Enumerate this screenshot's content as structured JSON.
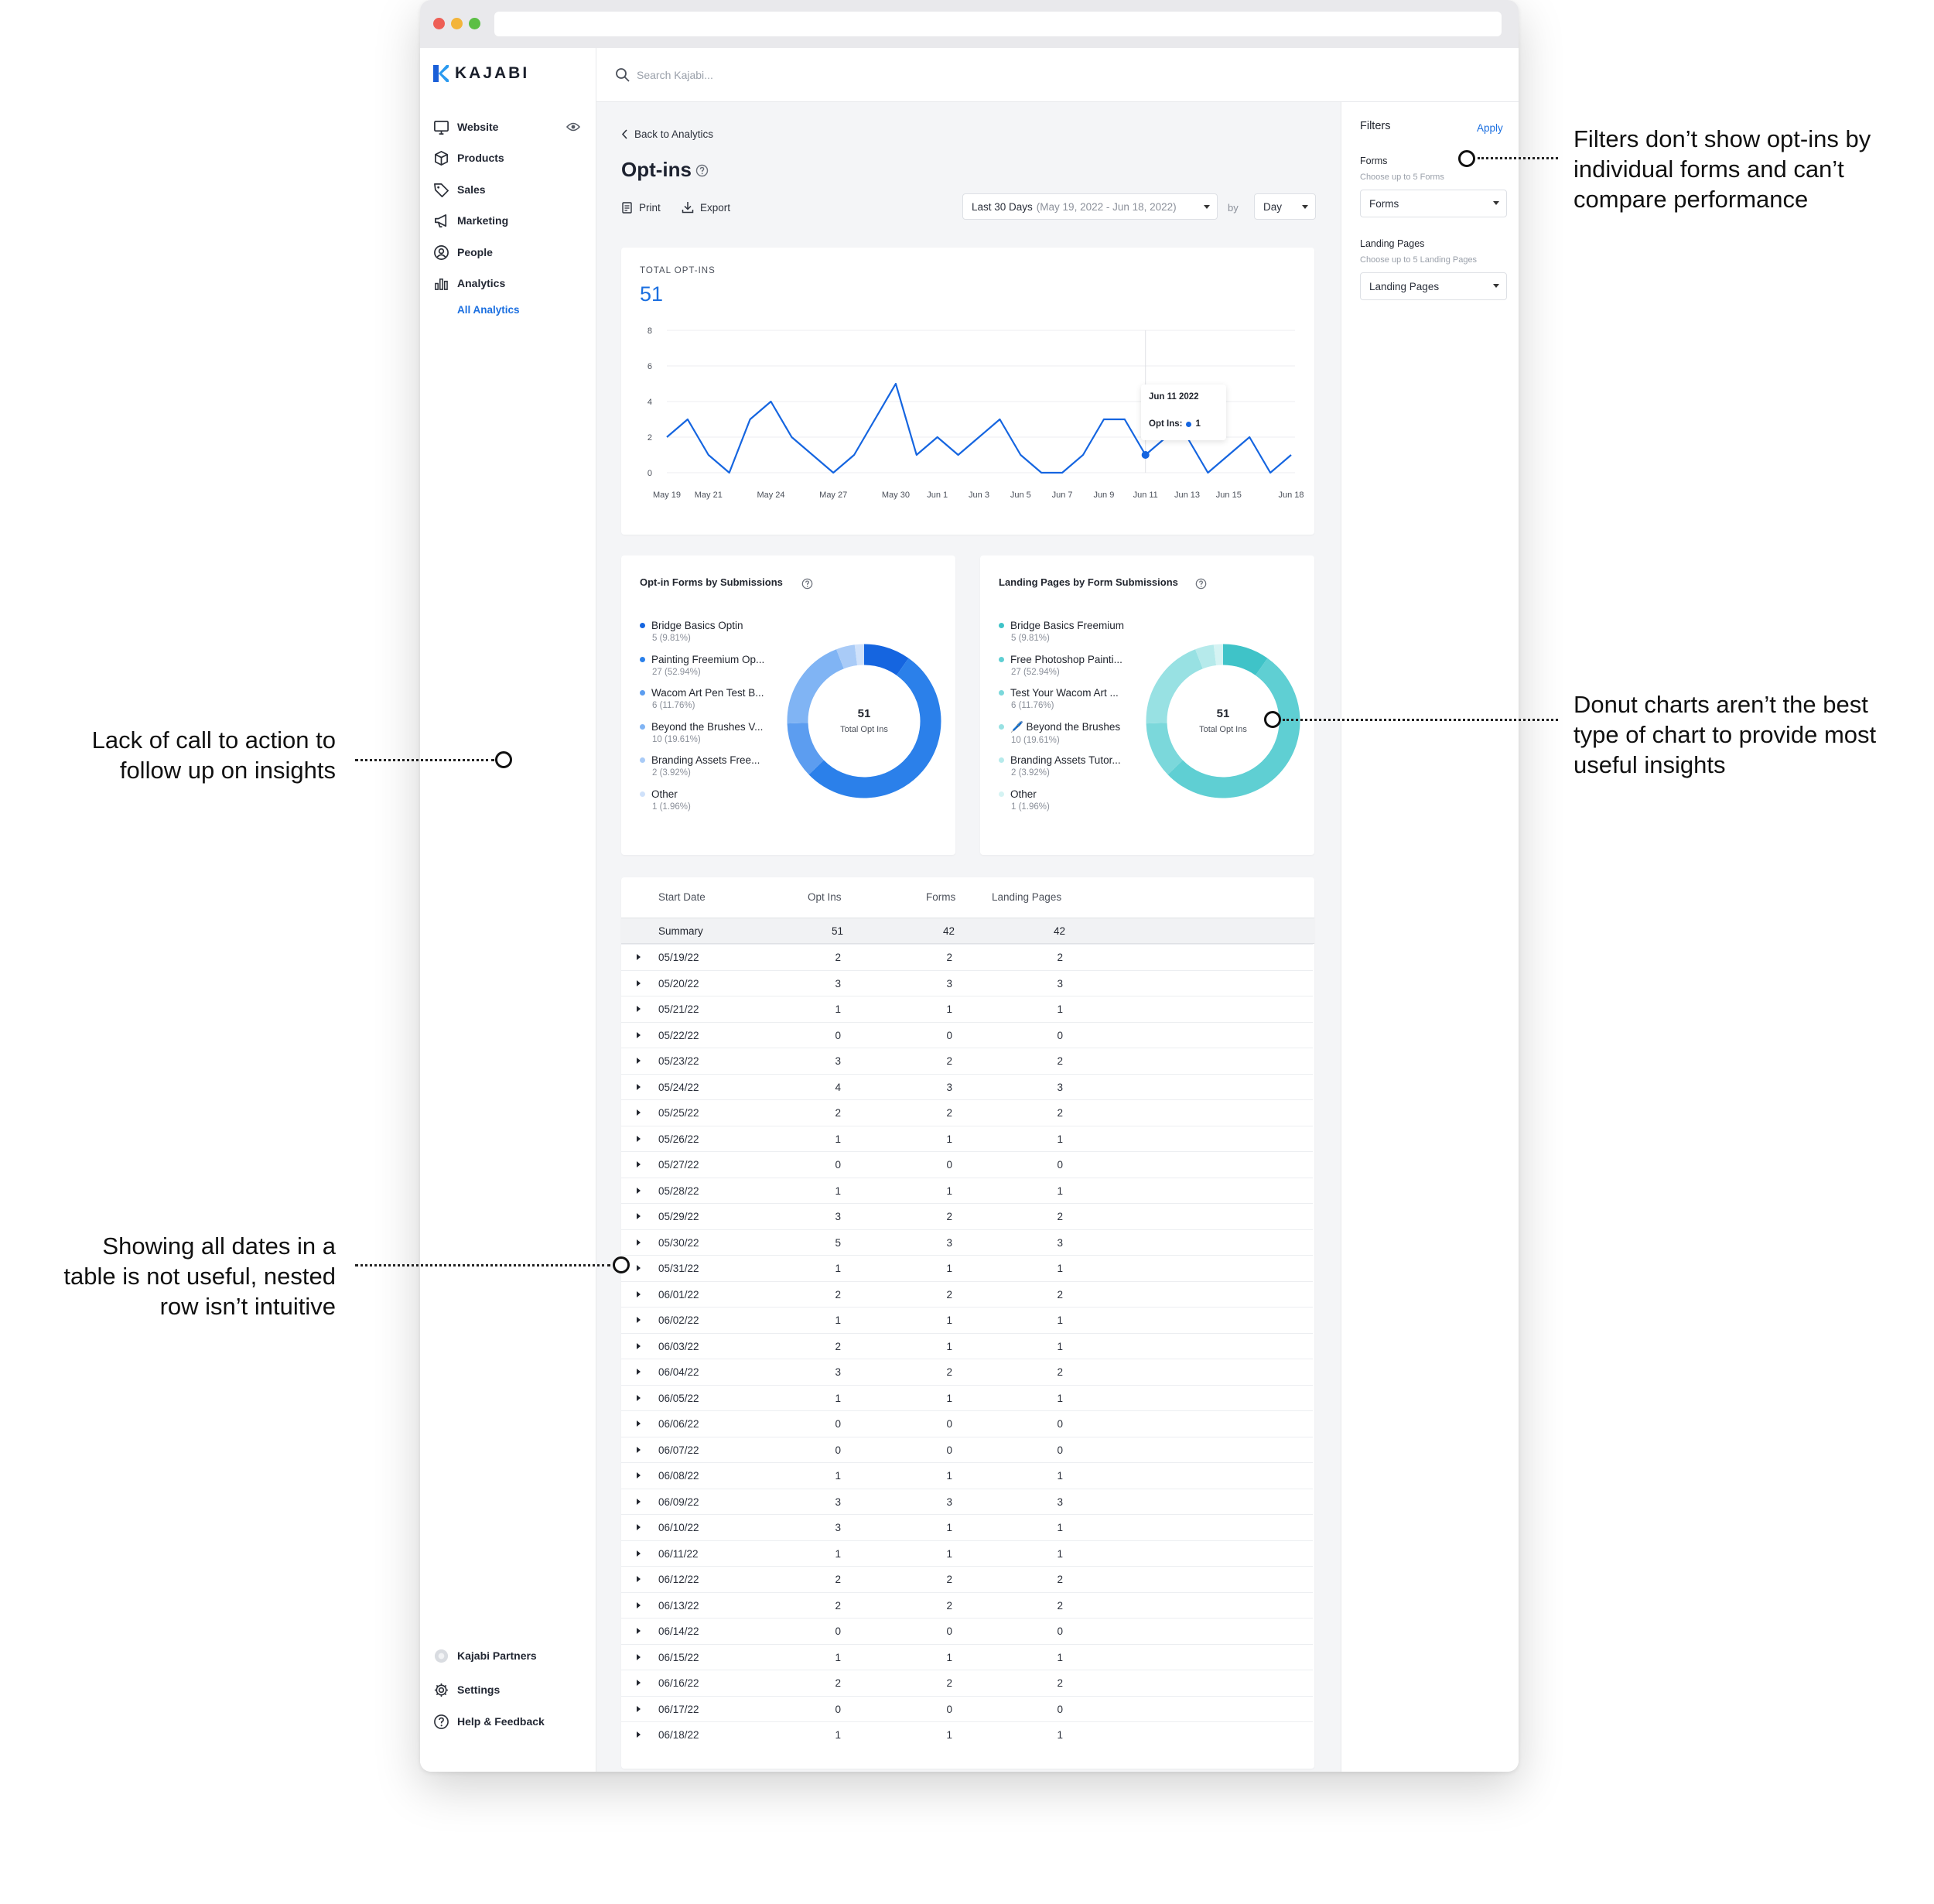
{
  "app": {
    "logo": "KAJABI"
  },
  "search": {
    "placeholder": "Search Kajabi..."
  },
  "sidebar": {
    "items": [
      {
        "label": "Website",
        "icon": "monitor-icon"
      },
      {
        "label": "Products",
        "icon": "box-icon"
      },
      {
        "label": "Sales",
        "icon": "tag-icon"
      },
      {
        "label": "Marketing",
        "icon": "megaphone-icon"
      },
      {
        "label": "People",
        "icon": "person-circle-icon"
      },
      {
        "label": "Analytics",
        "icon": "bar-chart-icon"
      }
    ],
    "sub_item": "All Analytics",
    "bottom": [
      {
        "label": "Kajabi Partners",
        "icon": "partner-icon"
      },
      {
        "label": "Settings",
        "icon": "gear-icon"
      },
      {
        "label": "Help & Feedback",
        "icon": "help-icon"
      }
    ]
  },
  "page": {
    "back": "Back to Analytics",
    "title": "Opt-ins",
    "print": "Print",
    "export": "Export",
    "range_main": "Last 30 Days",
    "range_dates": "(May 19, 2022 - Jun 18, 2022)",
    "by": "by",
    "interval": "Day"
  },
  "filters": {
    "title": "Filters",
    "apply": "Apply",
    "forms_label": "Forms",
    "forms_hint": "Choose up to 5 Forms",
    "forms_value": "Forms",
    "lp_label": "Landing Pages",
    "lp_hint": "Choose up to 5 Landing Pages",
    "lp_value": "Landing Pages"
  },
  "total": {
    "label": "TOTAL OPT-INS",
    "value": "51"
  },
  "chart_data": [
    {
      "type": "line",
      "x": [
        "May 19",
        "May 20",
        "May 21",
        "May 22",
        "May 23",
        "May 24",
        "May 25",
        "May 26",
        "May 27",
        "May 28",
        "May 29",
        "May 30",
        "May 31",
        "Jun 1",
        "Jun 2",
        "Jun 3",
        "Jun 4",
        "Jun 5",
        "Jun 6",
        "Jun 7",
        "Jun 8",
        "Jun 9",
        "Jun 10",
        "Jun 11",
        "Jun 12",
        "Jun 13",
        "Jun 14",
        "Jun 15",
        "Jun 16",
        "Jun 17",
        "Jun 18"
      ],
      "series": [
        {
          "name": "Opt Ins",
          "values": [
            2,
            3,
            1,
            0,
            3,
            4,
            2,
            1,
            0,
            1,
            3,
            5,
            1,
            2,
            1,
            2,
            3,
            1,
            0,
            0,
            1,
            3,
            3,
            1,
            2,
            2,
            0,
            1,
            2,
            0,
            1
          ]
        }
      ],
      "x_tick_labels": [
        "May 19",
        "May 21",
        "May 24",
        "May 27",
        "May 30",
        "Jun 1",
        "Jun 3",
        "Jun 5",
        "Jun 7",
        "Jun 9",
        "Jun 11",
        "Jun 13",
        "Jun 15",
        "Jun 18"
      ],
      "y_ticks": [
        "0",
        "2",
        "4",
        "6",
        "8"
      ],
      "ylim": [
        0,
        8
      ],
      "grid": true,
      "tooltip": {
        "date": "Jun 11 2022",
        "label": "Opt Ins:",
        "value": "1"
      }
    },
    {
      "type": "pie",
      "title": "Opt-in Forms by Submissions",
      "center_value": "51",
      "center_label": "Total Opt Ins",
      "slices": [
        {
          "name": "Bridge Basics Optin",
          "value": 5,
          "pct": "5 (9.81%)",
          "color": "#1565e0"
        },
        {
          "name": "Painting Freemium Op...",
          "value": 27,
          "pct": "27 (52.94%)",
          "color": "#2b80ea"
        },
        {
          "name": "Wacom Art Pen Test B...",
          "value": 6,
          "pct": "6 (11.76%)",
          "color": "#5c9df0"
        },
        {
          "name": "Beyond the Brushes V...",
          "value": 10,
          "pct": "10 (19.61%)",
          "color": "#80b4f4"
        },
        {
          "name": "Branding Assets Free...",
          "value": 2,
          "pct": "2 (3.92%)",
          "color": "#a9cbf7"
        },
        {
          "name": "Other",
          "value": 1,
          "pct": "1 (1.96%)",
          "color": "#cfe1fa"
        }
      ]
    },
    {
      "type": "pie",
      "title": "Landing Pages by Form Submissions",
      "center_value": "51",
      "center_label": "Total Opt Ins",
      "slices": [
        {
          "name": "Bridge Basics Freemium",
          "value": 5,
          "pct": "5 (9.81%)",
          "color": "#3fc3c8"
        },
        {
          "name": "Free Photoshop Painti...",
          "value": 27,
          "pct": "27 (52.94%)",
          "color": "#5fcfd3"
        },
        {
          "name": "Test Your Wacom Art ...",
          "value": 6,
          "pct": "6 (11.76%)",
          "color": "#7bd8db"
        },
        {
          "name": "🖊️ Beyond the Brushes",
          "value": 10,
          "pct": "10 (19.61%)",
          "color": "#98e1e3"
        },
        {
          "name": "Branding Assets Tutor...",
          "value": 2,
          "pct": "2 (3.92%)",
          "color": "#b6eaeb"
        },
        {
          "name": "Other",
          "value": 1,
          "pct": "1 (1.96%)",
          "color": "#d5f3f3"
        }
      ]
    }
  ],
  "table": {
    "headers": [
      "Start Date",
      "Opt Ins",
      "Forms",
      "Landing Pages"
    ],
    "summary": [
      "Summary",
      "51",
      "42",
      "42"
    ],
    "rows": [
      [
        "05/19/22",
        "2",
        "2",
        "2"
      ],
      [
        "05/20/22",
        "3",
        "3",
        "3"
      ],
      [
        "05/21/22",
        "1",
        "1",
        "1"
      ],
      [
        "05/22/22",
        "0",
        "0",
        "0"
      ],
      [
        "05/23/22",
        "3",
        "2",
        "2"
      ],
      [
        "05/24/22",
        "4",
        "3",
        "3"
      ],
      [
        "05/25/22",
        "2",
        "2",
        "2"
      ],
      [
        "05/26/22",
        "1",
        "1",
        "1"
      ],
      [
        "05/27/22",
        "0",
        "0",
        "0"
      ],
      [
        "05/28/22",
        "1",
        "1",
        "1"
      ],
      [
        "05/29/22",
        "3",
        "2",
        "2"
      ],
      [
        "05/30/22",
        "5",
        "3",
        "3"
      ],
      [
        "05/31/22",
        "1",
        "1",
        "1"
      ],
      [
        "06/01/22",
        "2",
        "2",
        "2"
      ],
      [
        "06/02/22",
        "1",
        "1",
        "1"
      ],
      [
        "06/03/22",
        "2",
        "1",
        "1"
      ],
      [
        "06/04/22",
        "3",
        "2",
        "2"
      ],
      [
        "06/05/22",
        "1",
        "1",
        "1"
      ],
      [
        "06/06/22",
        "0",
        "0",
        "0"
      ],
      [
        "06/07/22",
        "0",
        "0",
        "0"
      ],
      [
        "06/08/22",
        "1",
        "1",
        "1"
      ],
      [
        "06/09/22",
        "3",
        "3",
        "3"
      ],
      [
        "06/10/22",
        "3",
        "1",
        "1"
      ],
      [
        "06/11/22",
        "1",
        "1",
        "1"
      ],
      [
        "06/12/22",
        "2",
        "2",
        "2"
      ],
      [
        "06/13/22",
        "2",
        "2",
        "2"
      ],
      [
        "06/14/22",
        "0",
        "0",
        "0"
      ],
      [
        "06/15/22",
        "1",
        "1",
        "1"
      ],
      [
        "06/16/22",
        "2",
        "2",
        "2"
      ],
      [
        "06/17/22",
        "0",
        "0",
        "0"
      ],
      [
        "06/18/22",
        "1",
        "1",
        "1"
      ]
    ]
  },
  "annotations": {
    "filters": [
      "Filters don’t show opt-ins by",
      "individual forms and can’t",
      "compare performance"
    ],
    "cta": [
      "Lack of call to action to",
      "follow up on insights"
    ],
    "donut": [
      "Donut charts aren’t the best",
      "type of chart to provide most",
      "useful insights"
    ],
    "table": [
      "Showing all dates in a",
      "table is not useful, nested",
      "row isn’t intuitive"
    ]
  },
  "colors": {
    "accent": "#1b6fe0",
    "line": "#1565e0",
    "teal": "#3fc3c8"
  }
}
